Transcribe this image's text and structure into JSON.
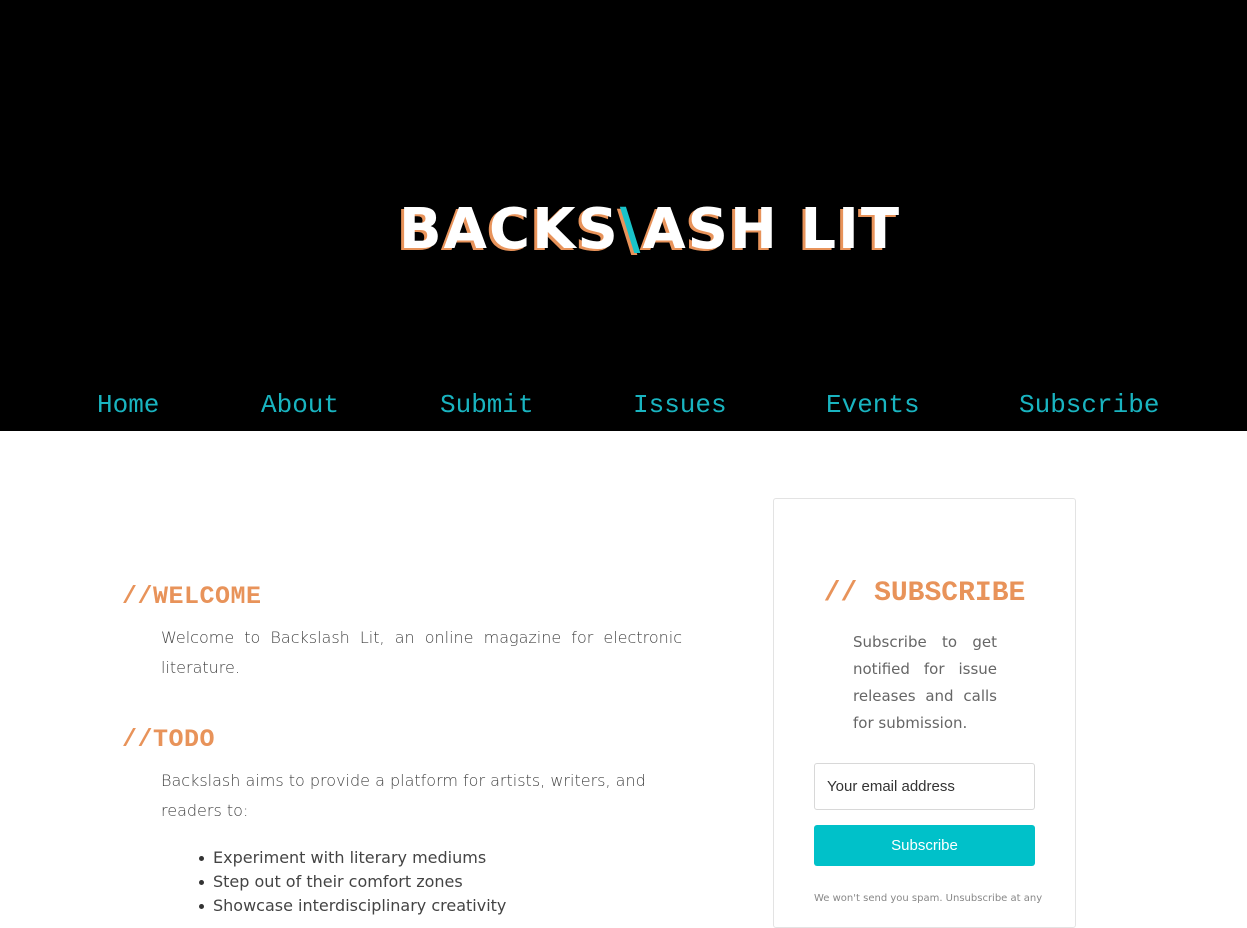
{
  "header": {
    "logo_before": "BACKS",
    "logo_slash": "\\",
    "logo_after": "ASH LIT"
  },
  "nav": {
    "items": [
      {
        "label": "Home"
      },
      {
        "label": "About"
      },
      {
        "label": "Submit"
      },
      {
        "label": "Issues"
      },
      {
        "label": "Events"
      },
      {
        "label": "Subscribe"
      }
    ]
  },
  "main": {
    "welcome_heading": "//WELCOME",
    "welcome_text": "Welcome to Backslash Lit, an online magazine for electronic literature.",
    "todo_heading": "//TODO",
    "todo_text": "Backslash aims to provide a platform for artists, writers, and readers to:",
    "todo_items": [
      "Experiment with literary mediums",
      "Step out of their comfort zones",
      "Showcase interdisciplinary creativity"
    ]
  },
  "subscribe_card": {
    "title": "// SUBSCRIBE",
    "description": "Subscribe to get notified for issue releases and calls for submission.",
    "email_placeholder": "Your email address",
    "button_label": "Subscribe",
    "note": "We won't send you spam. Unsubscribe at any"
  },
  "colors": {
    "accent_teal": "#19b4c0",
    "accent_orange": "#e8935a",
    "button_bg": "#00c1c9",
    "header_bg": "#000000"
  }
}
